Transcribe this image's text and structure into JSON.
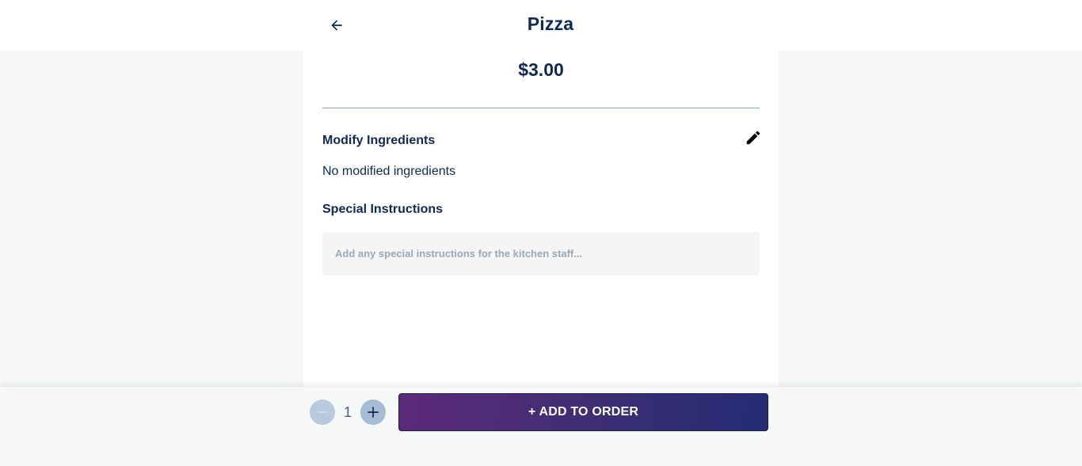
{
  "header": {
    "title": "Pizza",
    "back_icon": "arrow-left-icon"
  },
  "item": {
    "price": "$3.00"
  },
  "ingredients": {
    "title": "Modify Ingredients",
    "edit_icon": "pencil-icon",
    "status_text": "No modified ingredients"
  },
  "instructions": {
    "title": "Special Instructions",
    "value": "",
    "placeholder": "Add any special instructions for the kitchen staff..."
  },
  "footer": {
    "quantity": "1",
    "minus_icon": "minus-icon",
    "plus_icon": "plus-icon",
    "add_label": "+ ADD TO ORDER"
  },
  "colors": {
    "primary_text": "#0e2a52",
    "button_gradient_start": "#5e2a78",
    "button_gradient_end": "#232c74",
    "qty_button": "#a9bfd6",
    "background": "#f5f8f7"
  }
}
